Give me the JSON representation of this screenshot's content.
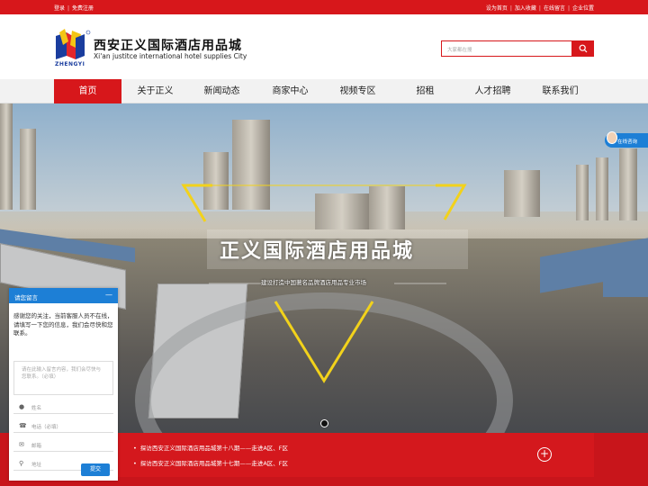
{
  "topbar": {
    "login": "登录",
    "register": "免费注册",
    "set_home": "设为首页",
    "add_fav": "加入收藏",
    "online_msg": "在线留言",
    "company_location": "企业位置"
  },
  "brand": {
    "logo_word": "ZHENGYI",
    "name_cn": "西安正义国际酒店用品城",
    "name_en": "Xi'an justitce international hotel supplies City"
  },
  "search": {
    "placeholder": "大家都在搜"
  },
  "nav": {
    "items": [
      "首页",
      "关于正义",
      "新闻动态",
      "商家中心",
      "视频专区",
      "招租",
      "人才招聘",
      "联系我们"
    ]
  },
  "banner": {
    "title": "正义国际酒店用品城",
    "subtitle": "建设打造中国著名品牌酒店用品专业市场"
  },
  "consult": {
    "label": "在线咨询"
  },
  "news": {
    "items": [
      "探访西安正义国际酒店用品城第十八期——走进A区、F区",
      "探访西安正义国际酒店用品城第十七期——走进A区、F区"
    ]
  },
  "message_widget": {
    "title": "请您留言",
    "minimize": "—",
    "intro": "感谢您的关注，当前客服人员不在线，请填写一下您的信息，我们会尽快和您联系。",
    "content_placeholder": "请在此输入留言内容，我们会尽快与您联系。（必填）",
    "name_placeholder": "姓名",
    "phone_placeholder": "电话（必填）",
    "email_placeholder": "邮箱",
    "address_placeholder": "地址",
    "submit": "提交"
  },
  "colors": {
    "brand_red": "#d7171b",
    "widget_blue": "#1d7fd6",
    "accent_yellow": "#f2d21b"
  }
}
